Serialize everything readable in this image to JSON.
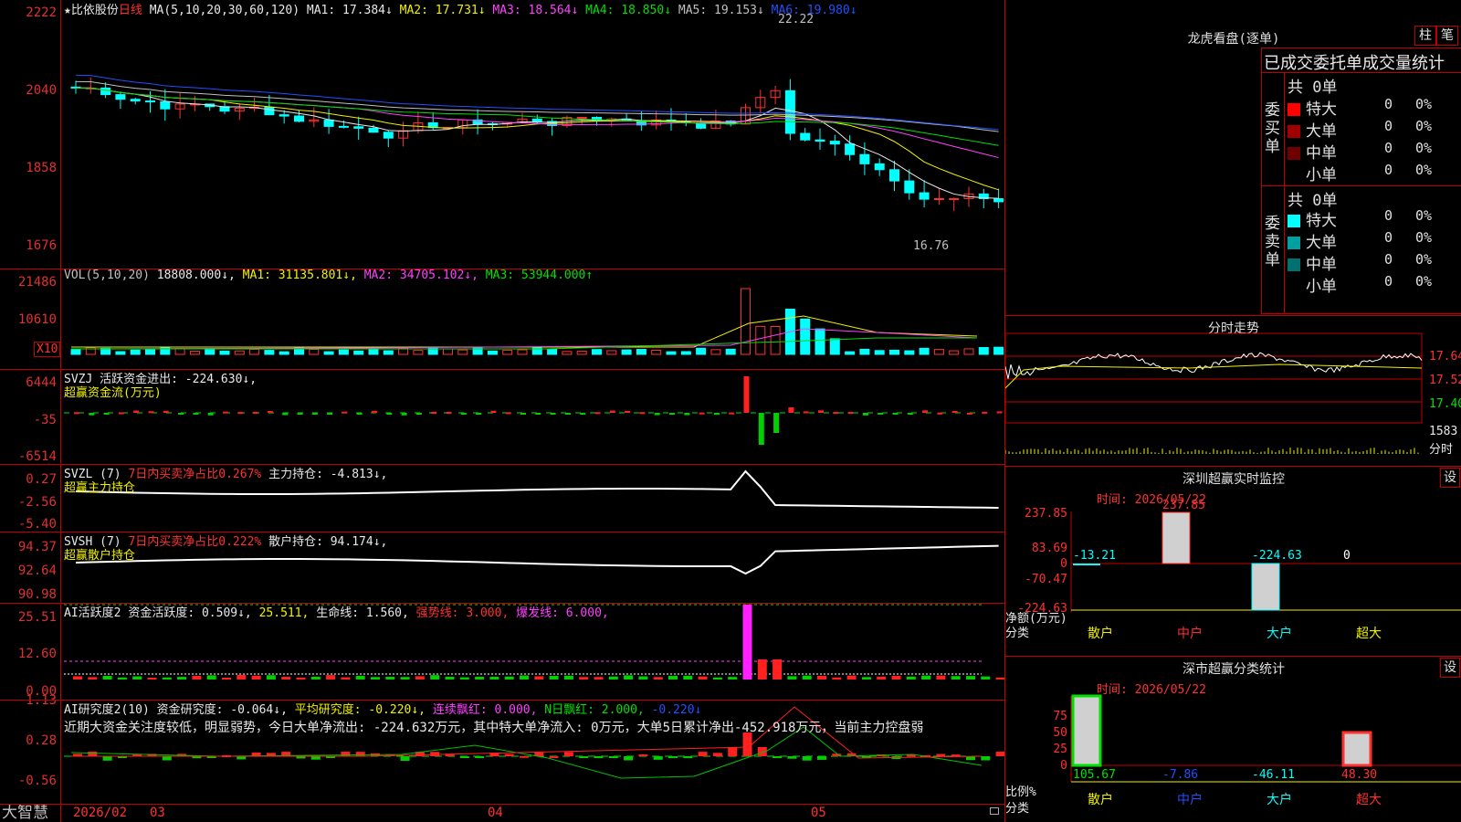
{
  "kline": {
    "star": "★",
    "stock_name": "比依股份",
    "period": "日线",
    "ma_params": "MA(5,10,20,30,60,120)",
    "ma": [
      {
        "label": "MA1: 17.384↓",
        "color": "#e8e8e8"
      },
      {
        "label": "MA2: 17.731↓",
        "color": "#f0f000"
      },
      {
        "label": "MA3: 18.564↓",
        "color": "#ff40ff"
      },
      {
        "label": "MA4: 18.850↓",
        "color": "#00e000"
      },
      {
        "label": "MA5: 19.153↓",
        "color": "#c0c0c0"
      },
      {
        "label": "MA6: 19.980↓",
        "color": "#2050ff"
      }
    ],
    "y_ticks": [
      "2222",
      "2040",
      "1858",
      "1676"
    ],
    "high_label": "22.22",
    "low_label": "16.76"
  },
  "volume": {
    "header_name": "VOL(5,10,20)",
    "value": "18808.000↓,",
    "ma1": "MA1: 31135.801↓,",
    "ma2": "MA2: 34705.102↓,",
    "ma3": "MA3: 53944.000↑",
    "y_ticks": [
      "21486",
      "10610"
    ],
    "unit": "X10"
  },
  "fund_flow": {
    "header": "SVZJ  活跃资金进出: -224.630↓,",
    "subtitle": "超赢资金流(万元)",
    "y_ticks": [
      "6444",
      "-35",
      "-6514"
    ]
  },
  "main_hold": {
    "header_a": "SVZL (7)",
    "header_b": "7日内买卖净占比0.267%",
    "header_c": "主力持仓: -4.813↓,",
    "subtitle": "超赢主力持仓",
    "y_ticks": [
      "0.27",
      "-2.56",
      "-5.40"
    ]
  },
  "retail_hold": {
    "header_a": "SVSH (7)",
    "header_b": "7日内买卖净占比0.222%",
    "header_c": "散户持仓: 94.174↓,",
    "subtitle": "超赢散户持仓",
    "y_ticks": [
      "94.37",
      "92.64",
      "90.98"
    ]
  },
  "ai_active": {
    "h1": "AI活跃度2",
    "h2": "资金活跃度: 0.509↓,",
    "h3": "25.511,",
    "h4": "生命线: 1.560,",
    "h5": "强势线: 3.000,",
    "h6": "爆发线: 6.000,",
    "y_ticks": [
      "25.51",
      "12.60",
      "0.00"
    ]
  },
  "ai_research": {
    "h1": "AI研究度2(10)",
    "h2": "资金研究度: -0.064↓,",
    "h3": "平均研究度: -0.220↓,",
    "h4": "连续飘红: 0.000,",
    "h5": "N日飘红: 2.000,",
    "h6": "-0.220↓",
    "comment": "近期大资金关注度较低，明显弱势，今日大单净流出: -224.632万元，其中特大单净流入: 0万元，大单5日累计净出-452.918万元，当前主力控盘弱",
    "y_ticks": [
      "1.13",
      "0.28",
      "-0.56"
    ]
  },
  "bottom_bar": {
    "brand": "大智慧",
    "dates": [
      "2026/02",
      "03",
      "04",
      "05"
    ]
  },
  "dragon_tiger": {
    "title": "龙虎看盘(逐单)",
    "btn_zhu": "柱",
    "btn_bi": "笔",
    "table_title": "已成交委托单成交量统计",
    "buy_total": "共 0单",
    "buy_label": "委买单",
    "sell_total": "共 0单",
    "sell_label": "委卖单",
    "buy_rows": [
      {
        "name": "特大",
        "count": "0",
        "pct": "0%",
        "color": "#ff0000"
      },
      {
        "name": "大单",
        "count": "0",
        "pct": "0%",
        "color": "#a00000"
      },
      {
        "name": "中单",
        "count": "0",
        "pct": "0%",
        "color": "#700000"
      },
      {
        "name": "小单",
        "count": "0",
        "pct": "0%",
        "color": "#000000"
      }
    ],
    "sell_rows": [
      {
        "name": "特大",
        "count": "0",
        "pct": "0%",
        "color": "#00ffff"
      },
      {
        "name": "大单",
        "count": "0",
        "pct": "0%",
        "color": "#00a0a0"
      },
      {
        "name": "中单",
        "count": "0",
        "pct": "0%",
        "color": "#007070"
      },
      {
        "name": "小单",
        "count": "0",
        "pct": "0%",
        "color": "#000000"
      }
    ]
  },
  "intraday": {
    "title": "分时走势",
    "y_ticks": [
      "17.64",
      "17.52",
      "17.40"
    ],
    "vol_tick": "1583",
    "vol_label": "分时"
  },
  "monitor": {
    "title": "深圳超赢实时监控",
    "btn": "设",
    "time": "时间: 2026/05/22",
    "y_ticks": [
      "237.85",
      "83.69",
      "0",
      "-70.47",
      "-224.63"
    ],
    "net_label": "净额(万元)",
    "cat_label": "分类",
    "values": [
      "-13.21",
      "237.85",
      "-224.63",
      "0"
    ],
    "categories": [
      "散户",
      "中户",
      "大户",
      "超大"
    ]
  },
  "classify": {
    "title": "深市超赢分类统计",
    "btn": "设",
    "time": "时间: 2026/05/22",
    "y_ticks": [
      "75",
      "50",
      "25",
      "0"
    ],
    "ratio_label": "比例%",
    "cat_label": "分类",
    "values": [
      "105.67",
      "-7.86",
      "-46.11",
      "48.30"
    ],
    "categories": [
      "散户",
      "中户",
      "大户",
      "超大"
    ]
  }
}
